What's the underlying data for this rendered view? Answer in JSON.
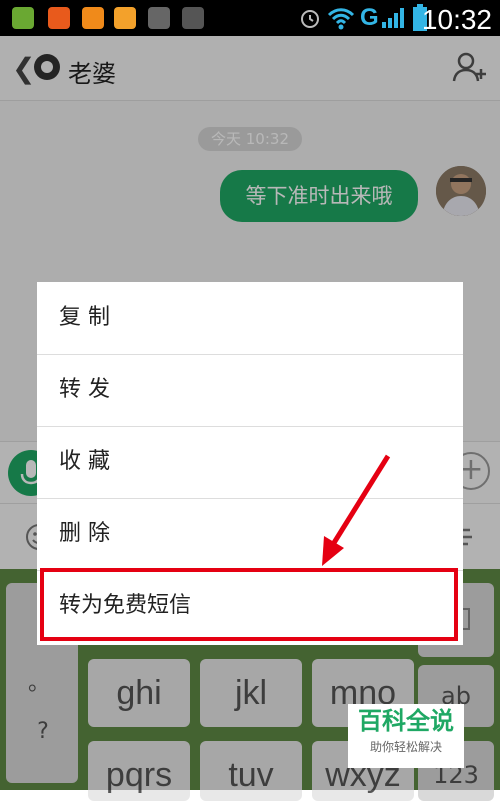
{
  "status_bar": {
    "time": "10:32",
    "network": "G"
  },
  "header": {
    "title": "老婆"
  },
  "chat": {
    "timestamp": "今天 10:32",
    "message": "等下准时出来哦"
  },
  "context_menu": {
    "items": [
      {
        "label": "复 制"
      },
      {
        "label": "转 发"
      },
      {
        "label": "收 藏"
      },
      {
        "label": "删 除"
      },
      {
        "label": "转为免费短信"
      }
    ],
    "highlight_color": "#e50012"
  },
  "keyboard": {
    "keys": [
      {
        "label": "ghi"
      },
      {
        "label": "jkl"
      },
      {
        "label": "mno"
      },
      {
        "label": "ab"
      },
      {
        "label": "pqrs"
      },
      {
        "label": "tuv"
      },
      {
        "label": "wxyz"
      },
      {
        "label": "123"
      },
      {
        "label": "。"
      },
      {
        "label": "?"
      }
    ]
  },
  "watermark": {
    "title": "百科全说",
    "subtitle": "助你轻松解决"
  },
  "colors": {
    "brand_green": "#1fa864",
    "keyboard_bg": "#5f8a45",
    "arrow_red": "#e50012"
  }
}
